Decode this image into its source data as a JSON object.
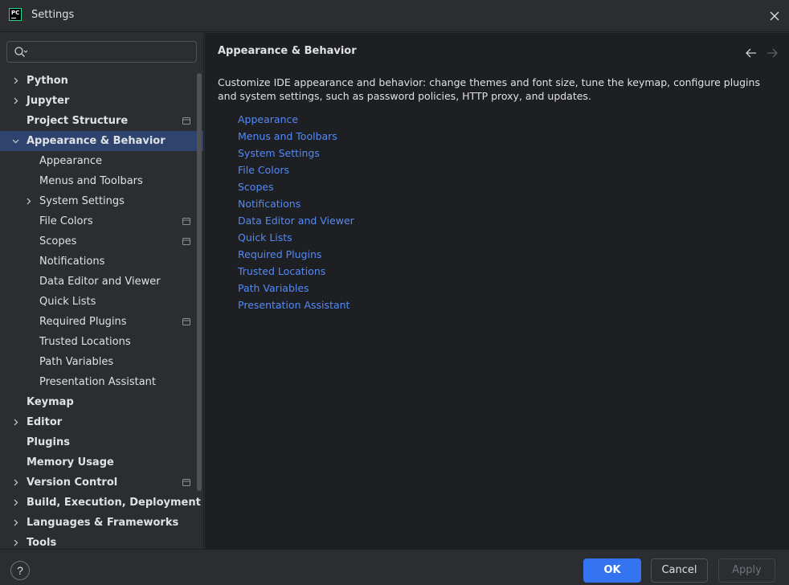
{
  "window": {
    "title": "Settings",
    "logo_text": "PC"
  },
  "search": {
    "value": "",
    "placeholder": ""
  },
  "sidebar": {
    "items": [
      {
        "label": "Python",
        "level": 0,
        "expandable": true,
        "expanded": false,
        "project_icon": false,
        "selected": false
      },
      {
        "label": "Jupyter",
        "level": 0,
        "expandable": true,
        "expanded": false,
        "project_icon": false,
        "selected": false
      },
      {
        "label": "Project Structure",
        "level": 0,
        "expandable": false,
        "expanded": false,
        "project_icon": true,
        "selected": false
      },
      {
        "label": "Appearance & Behavior",
        "level": 0,
        "expandable": true,
        "expanded": true,
        "project_icon": false,
        "selected": true
      },
      {
        "label": "Appearance",
        "level": 1,
        "expandable": false,
        "expanded": false,
        "project_icon": false,
        "selected": false
      },
      {
        "label": "Menus and Toolbars",
        "level": 1,
        "expandable": false,
        "expanded": false,
        "project_icon": false,
        "selected": false
      },
      {
        "label": "System Settings",
        "level": 1,
        "expandable": true,
        "expanded": false,
        "project_icon": false,
        "selected": false
      },
      {
        "label": "File Colors",
        "level": 1,
        "expandable": false,
        "expanded": false,
        "project_icon": true,
        "selected": false
      },
      {
        "label": "Scopes",
        "level": 1,
        "expandable": false,
        "expanded": false,
        "project_icon": true,
        "selected": false
      },
      {
        "label": "Notifications",
        "level": 1,
        "expandable": false,
        "expanded": false,
        "project_icon": false,
        "selected": false
      },
      {
        "label": "Data Editor and Viewer",
        "level": 1,
        "expandable": false,
        "expanded": false,
        "project_icon": false,
        "selected": false
      },
      {
        "label": "Quick Lists",
        "level": 1,
        "expandable": false,
        "expanded": false,
        "project_icon": false,
        "selected": false
      },
      {
        "label": "Required Plugins",
        "level": 1,
        "expandable": false,
        "expanded": false,
        "project_icon": true,
        "selected": false
      },
      {
        "label": "Trusted Locations",
        "level": 1,
        "expandable": false,
        "expanded": false,
        "project_icon": false,
        "selected": false
      },
      {
        "label": "Path Variables",
        "level": 1,
        "expandable": false,
        "expanded": false,
        "project_icon": false,
        "selected": false
      },
      {
        "label": "Presentation Assistant",
        "level": 1,
        "expandable": false,
        "expanded": false,
        "project_icon": false,
        "selected": false
      },
      {
        "label": "Keymap",
        "level": 0,
        "expandable": false,
        "expanded": false,
        "project_icon": false,
        "selected": false
      },
      {
        "label": "Editor",
        "level": 0,
        "expandable": true,
        "expanded": false,
        "project_icon": false,
        "selected": false
      },
      {
        "label": "Plugins",
        "level": 0,
        "expandable": false,
        "expanded": false,
        "project_icon": false,
        "selected": false
      },
      {
        "label": "Memory Usage",
        "level": 0,
        "expandable": false,
        "expanded": false,
        "project_icon": false,
        "selected": false
      },
      {
        "label": "Version Control",
        "level": 0,
        "expandable": true,
        "expanded": false,
        "project_icon": true,
        "selected": false
      },
      {
        "label": "Build, Execution, Deployment",
        "level": 0,
        "expandable": true,
        "expanded": false,
        "project_icon": false,
        "selected": false
      },
      {
        "label": "Languages & Frameworks",
        "level": 0,
        "expandable": true,
        "expanded": false,
        "project_icon": false,
        "selected": false
      },
      {
        "label": "Tools",
        "level": 0,
        "expandable": true,
        "expanded": false,
        "project_icon": false,
        "selected": false
      }
    ]
  },
  "main": {
    "title": "Appearance & Behavior",
    "description": "Customize IDE appearance and behavior: change themes and font size, tune the keymap, configure plugins and system settings, such as password policies, HTTP proxy, and updates.",
    "links": [
      "Appearance",
      "Menus and Toolbars",
      "System Settings",
      "File Colors",
      "Scopes",
      "Notifications",
      "Data Editor and Viewer",
      "Quick Lists",
      "Required Plugins",
      "Trusted Locations",
      "Path Variables",
      "Presentation Assistant"
    ]
  },
  "footer": {
    "help_label": "?",
    "ok_label": "OK",
    "cancel_label": "Cancel",
    "apply_label": "Apply"
  },
  "colors": {
    "accent": "#3574f0",
    "link": "#548af7",
    "selection": "#2e436e"
  }
}
